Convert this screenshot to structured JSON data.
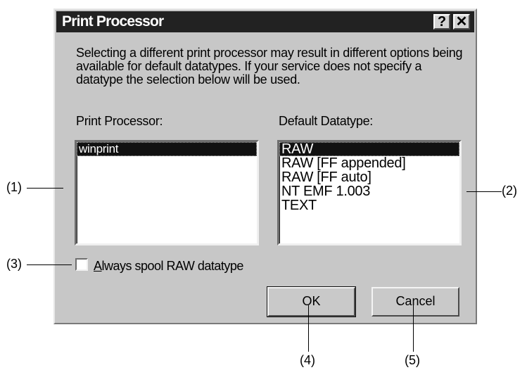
{
  "dialog": {
    "title": "Print Processor",
    "help_glyph": "?",
    "close_glyph": "✕",
    "description": "Selecting a different print processor may result in different options being available for default datatypes. If your service does not specify a datatype the selection below will be used.",
    "processor_label": "Print Processor:",
    "processors": [
      "winprint"
    ],
    "datatype_label": "Default Datatype:",
    "datatypes": [
      "RAW",
      "RAW [FF appended]",
      "RAW [FF auto]",
      "NT EMF 1.003",
      "TEXT"
    ],
    "always_spool_prefix": "A",
    "always_spool_rest": "lways spool RAW datatype",
    "always_spool_checked": false,
    "ok_label": "OK",
    "cancel_label": "Cancel"
  },
  "callouts": {
    "c1": "(1)",
    "c2": "(2)",
    "c3": "(3)",
    "c4": "(4)",
    "c5": "(5)"
  }
}
